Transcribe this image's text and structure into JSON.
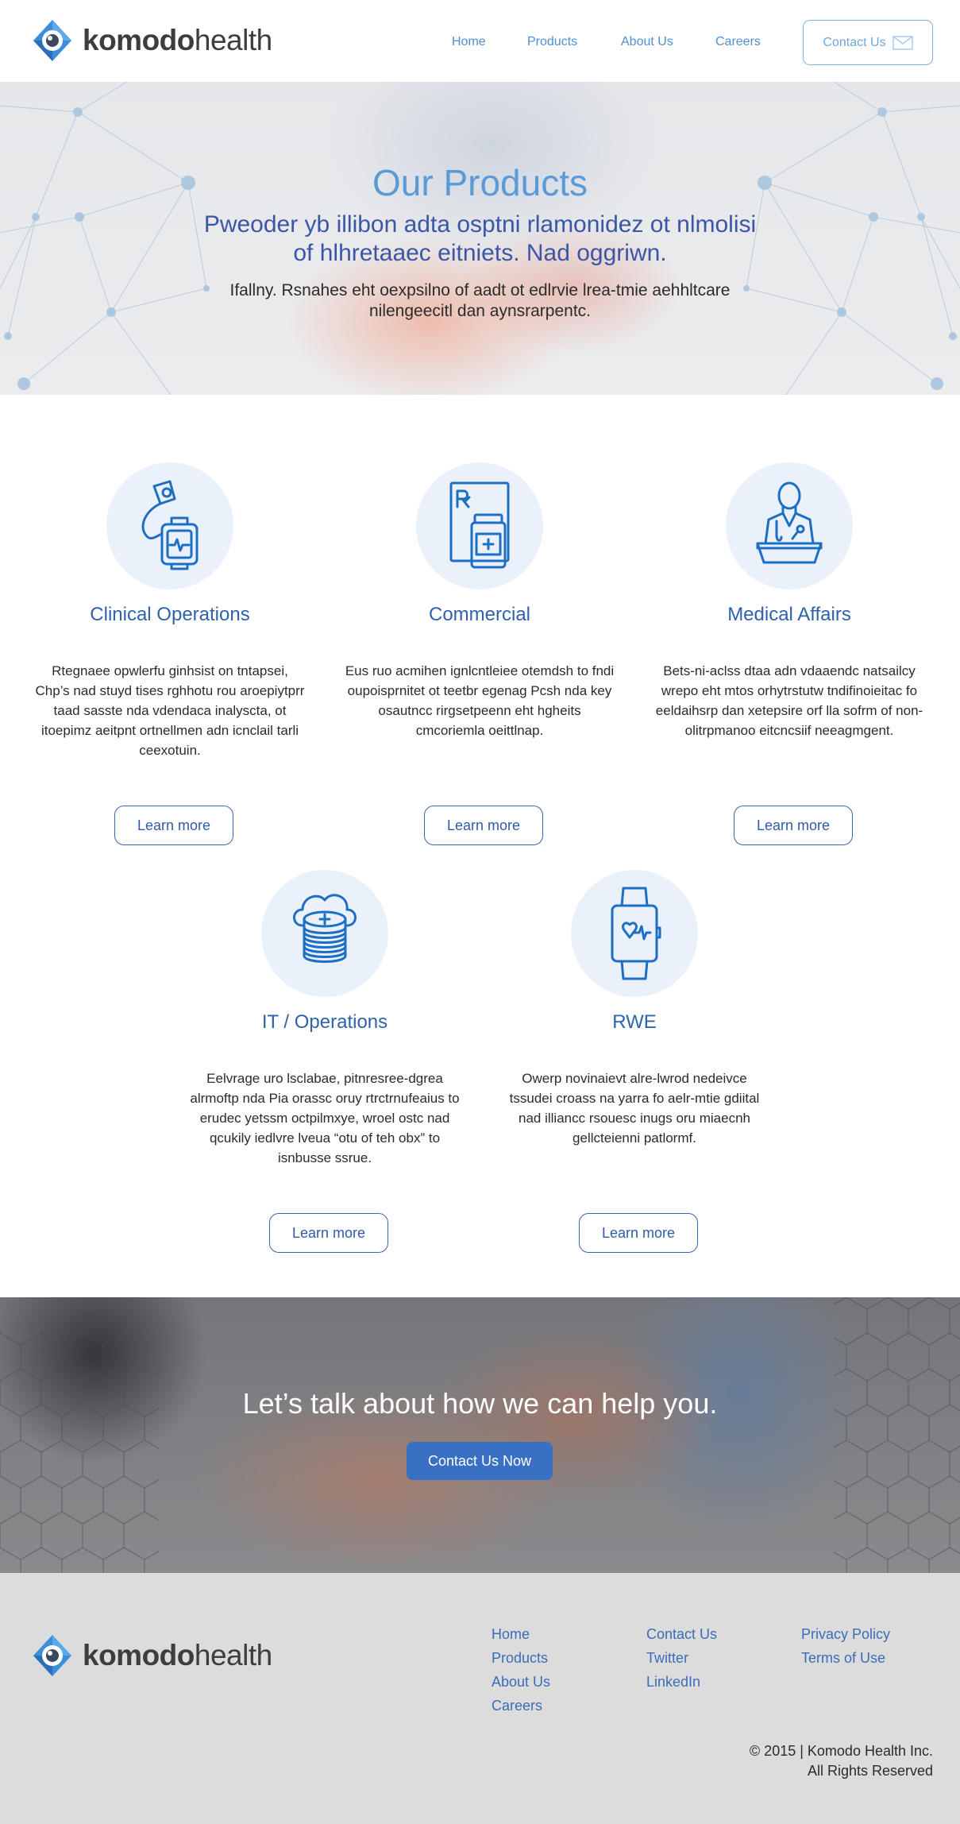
{
  "header": {
    "logo_bold": "komodo",
    "logo_light": "health",
    "nav": [
      {
        "label": "Home"
      },
      {
        "label": "Products"
      },
      {
        "label": "About Us"
      },
      {
        "label": "Careers"
      }
    ],
    "contact_label": "Contact Us"
  },
  "hero": {
    "title": "Our Products",
    "subtitle": "Pweoder yb illibon adta osptni rlamonidez ot nlmolisi of hlhretaaec eitniets. Nad oggriwn.",
    "description": "Ifallny. Rsnahes eht oexpsilno of aadt ot edlrvie lrea-tmie aehhltcare nilengeecitl dan aynsrarpentc."
  },
  "products": [
    {
      "title": "Clinical Operations",
      "icon": "clinical-device-icon",
      "description": "Rtegnaee opwlerfu ginhsist on tntapsei, Chp’s nad stuyd tises rghhotu rou aroepiytprr taad sasste nda vdendaca inalyscta, ot itoepimz aeitpnt ortnellmen adn icnclail tarli ceexotuin.",
      "button": "Learn more"
    },
    {
      "title": "Commercial",
      "icon": "prescription-bottle-icon",
      "description": "Eus ruo acmihen ignlcntleiee otemdsh to fndi oupoisprnitet ot teetbr egenag Pcsh nda key osautncc rirgsetpeenn eht hgheits cmcoriemla oeittlnap.",
      "button": "Learn more"
    },
    {
      "title": "Medical Affairs",
      "icon": "doctor-icon",
      "description": "Bets-ni-aclss dtaa adn vdaaendc natsailcy wrepo eht mtos orhytrstutw tndifinoieitac fo eeldaihsrp dan xetepsire orf lla sofrm of non-olitrpmanoo eitcncsiif neeagmgent.",
      "button": "Learn more"
    },
    {
      "title": "IT / Operations",
      "icon": "cloud-data-icon",
      "description": "Eelvrage uro lsclabae, pitnresree-dgrea alrmoftp nda Pia orassc oruy rtrctrnufeaius to erudec yetssm octpilmxye, wroel ostc nad qcukily iedlvre lveua “otu of teh obx” to isnbusse ssrue.",
      "button": "Learn more"
    },
    {
      "title": "RWE",
      "icon": "smartwatch-heart-icon",
      "description": "Owerp novinaievt alre-lwrod nedeivce tssudei croass na yarra fo aelr-mtie gdiital nad illiancc rsouesc inugs oru miaecnh gellcteienni patlormf.",
      "button": "Learn more"
    }
  ],
  "cta": {
    "title": "Let’s talk about how we can help you.",
    "button": "Contact Us Now"
  },
  "footer": {
    "logo_bold": "komodo",
    "logo_light": "health",
    "col1": [
      "Home",
      "Products",
      "About Us",
      "Careers"
    ],
    "col2": [
      "Contact Us",
      "Twitter",
      "LinkedIn"
    ],
    "col3": [
      "Privacy Policy",
      "Terms of Use"
    ],
    "copyright_line1": "© 2015 | Komodo Health Inc.",
    "copyright_line2": "All Rights Reserved"
  },
  "colors": {
    "brand_blue": "#2f62aa",
    "nav_blue": "#4f8fd1",
    "cta_button": "#3a70c4",
    "icon_circle": "#eaf1fa"
  }
}
